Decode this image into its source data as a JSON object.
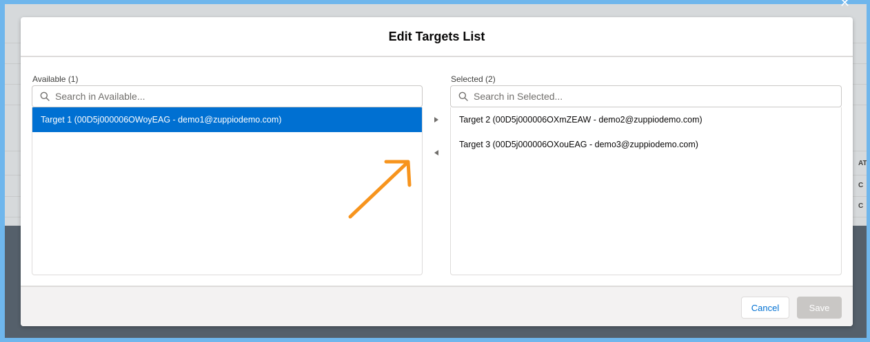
{
  "modal": {
    "title": "Edit Targets List"
  },
  "available": {
    "label": "Available (1)",
    "search_placeholder": "Search in Available...",
    "items": [
      {
        "label": "Target 1 (00D5j000006OWoyEAG - demo1@zuppiodemo.com)",
        "selected": true
      }
    ]
  },
  "selected": {
    "label": "Selected (2)",
    "search_placeholder": "Search in Selected...",
    "items": [
      {
        "label": "Target 2 (00D5j000006OXmZEAW - demo2@zuppiodemo.com)",
        "selected": false
      },
      {
        "label": "Target 3 (00D5j000006OXouEAG - demo3@zuppiodemo.com)",
        "selected": false
      }
    ]
  },
  "footer": {
    "cancel_label": "Cancel",
    "save_label": "Save"
  },
  "background": {
    "edge_text_1": "ATIC",
    "edge_text_2": "C",
    "edge_text_3": "C"
  },
  "colors": {
    "accent": "#0070d2",
    "annotation_arrow": "#f7941d",
    "frame": "#6fb6ec"
  },
  "icons": {
    "search": "search-icon",
    "move_right": "caret-right-icon",
    "move_left": "caret-left-icon",
    "close": "close-icon",
    "annotation": "arrow-annotation"
  }
}
